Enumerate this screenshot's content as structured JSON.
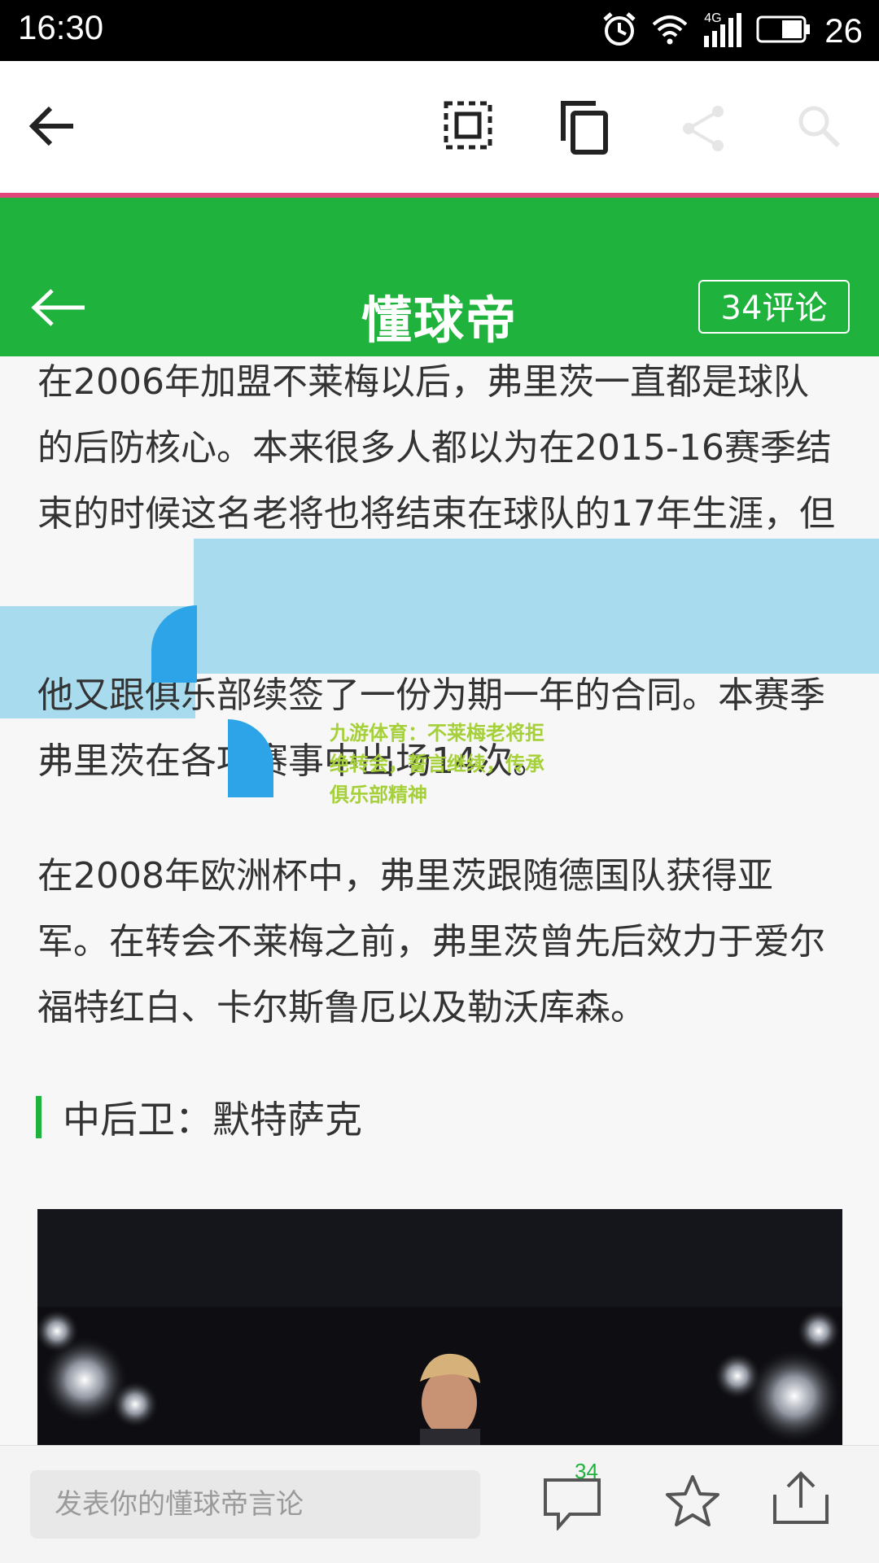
{
  "status_bar": {
    "time": "16:30",
    "network": "4G",
    "battery": "26",
    "icons": [
      "alarm-icon",
      "wifi-icon",
      "signal-icon",
      "battery-icon"
    ]
  },
  "toolbar": {
    "icons": [
      "back-arrow-icon",
      "select-all-icon",
      "copy-icon",
      "share-icon",
      "search-icon"
    ]
  },
  "app_bar": {
    "title": "懂球帝",
    "comments_button": "34评论",
    "accent_color": "#1fb33d"
  },
  "article": {
    "paragraph1": "在2006年加盟不莱梅以后，弗里茨一直都是球队的后防核心。本来很多人都以为在2015-16赛季结束的时候这名老将也将结束在球队的17年生涯，但",
    "paragraph2": "他又跟俱乐部续签了一份为期一年的合同。本赛季弗里茨在各项赛事中出场14次。",
    "paragraph3": "在2008年欧洲杯中，弗里茨跟随德国队获得亚军。在转会不莱梅之前，弗里茨曾先后效力于爱尔福特红白、卡尔斯鲁厄以及勒沃库森。",
    "overlay_text": "九游体育：不莱梅老将拒绝转会，誓言继续，传承俱乐部精神",
    "section_heading": "中后卫：默特萨克",
    "selection_color": "#a8dbee"
  },
  "bottom_bar": {
    "comment_placeholder": "发表你的懂球帝言论",
    "comment_count": "34",
    "icons": [
      "comment-icon",
      "star-icon",
      "share-upload-icon"
    ]
  }
}
